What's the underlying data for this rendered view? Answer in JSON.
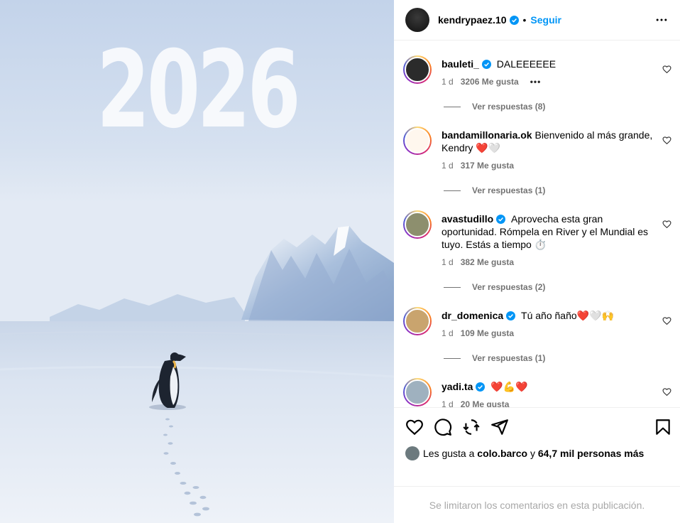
{
  "image": {
    "overlay_text": "2026",
    "alt": "Pingüino caminando en la Antártida"
  },
  "post_header": {
    "username": "kendrypaez.10",
    "separator": "•",
    "follow_label": "Seguir"
  },
  "comments": [
    {
      "user": "bauleti_",
      "verified": true,
      "text": "DALEEEEEE",
      "time": "1 d",
      "likes": "3206 Me gusta",
      "show_more": "•••",
      "replies": "Ver respuestas (8)"
    },
    {
      "user": "bandamillonaria.ok",
      "verified": false,
      "text": "Bienvenido al más grande, Kendry ❤️🤍",
      "time": "1 d",
      "likes": "317 Me gusta",
      "replies": "Ver respuestas (1)"
    },
    {
      "user": "avastudillo",
      "verified": true,
      "text": "Aprovecha esta gran oportunidad. Rómpela en River y el Mundial es tuyo. Estás a tiempo ⏱️",
      "time": "1 d",
      "likes": "382 Me gusta",
      "replies": "Ver respuestas (2)"
    },
    {
      "user": "dr_domenica",
      "verified": true,
      "text": "Tú año ñaño❤️🤍🙌",
      "time": "1 d",
      "likes": "109 Me gusta",
      "replies": "Ver respuestas (1)"
    },
    {
      "user": "yadi.ta",
      "verified": true,
      "text": "❤️💪❤️",
      "time": "1 d",
      "likes": "20 Me gusta"
    }
  ],
  "likes_line": {
    "prefix": "Les gusta a",
    "user": "colo.barco",
    "middle": "y",
    "count": "64,7 mil personas más"
  },
  "footer": {
    "text": "Se limitaron los comentarios en esta publicación."
  },
  "colors": {
    "accent": "#0095f6",
    "verified": "#0095f6",
    "secondary_text": "#737373",
    "footer_text": "#a8a8a8"
  }
}
